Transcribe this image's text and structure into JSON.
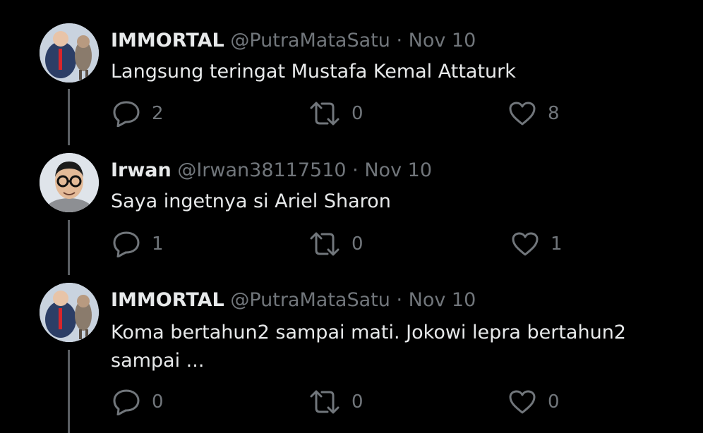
{
  "tweets": [
    {
      "display_name": "IMMORTAL",
      "handle": "@PutraMataSatu",
      "separator": "·",
      "date": "Nov 10",
      "text": "Langsung teringat Mustafa Kemal Attaturk",
      "replies": "2",
      "retweets": "0",
      "likes": "8"
    },
    {
      "display_name": "Irwan",
      "handle": "@Irwan38117510",
      "separator": "·",
      "date": "Nov 10",
      "text": "Saya ingetnya si Ariel Sharon",
      "replies": "1",
      "retweets": "0",
      "likes": "1"
    },
    {
      "display_name": "IMMORTAL",
      "handle": "@PutraMataSatu",
      "separator": "·",
      "date": "Nov 10",
      "text": "Koma bertahun2 sampai mati. Jokowi lepra bertahun2 sampai ...",
      "replies": "0",
      "retweets": "0",
      "likes": "0"
    }
  ],
  "colors": {
    "background": "#000000",
    "text": "#e7e9ea",
    "muted": "#71767b",
    "thread_line": "#5b5f63"
  }
}
